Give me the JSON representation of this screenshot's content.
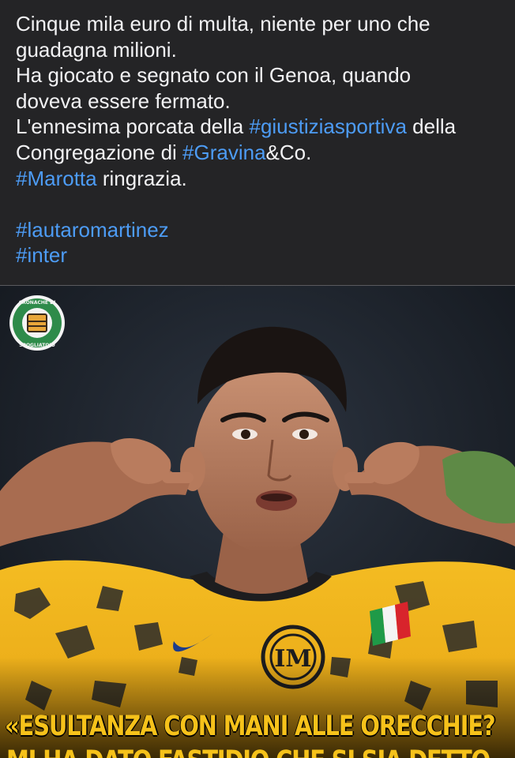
{
  "post": {
    "text_lines": {
      "l1": "Cinque mila euro di multa, niente per uno che",
      "l2": "guadagna milioni.",
      "l3": "Ha giocato e segnato con il Genoa, quando",
      "l4": "doveva essere fermato.",
      "l5_a": "L'ennesima porcata della ",
      "l5_tag": "#giustiziasportiva",
      "l5_b": " della",
      "l6_a": "Congregazione di ",
      "l6_tag": "#Gravina",
      "l6_b": "&Co.",
      "l7_tag": "#Marotta",
      "l7_b": " ringrazia."
    },
    "hashtags": {
      "tag1": "#lautaromartinez",
      "tag2": "#inter"
    }
  },
  "image": {
    "logo_text_top": "CRONACHE DI",
    "logo_text_bottom": "SPOGLIATOIO",
    "headline_line1": "«ESULTANZA CON MANI ALLE ORECCHIE?",
    "headline_line2": "MI HA DATO FASTIDIO CHE SI SIA DETTO"
  },
  "colors": {
    "background": "#242426",
    "text": "#f2f2f4",
    "hashtag": "#4d9cf5",
    "headline": "#f6c21a",
    "jersey": "#f0b31c",
    "logo": "#2e8b4a"
  },
  "icons": {
    "logo": "cronache-di-spogliatoio-logo-icon",
    "club_crest": "inter-crest-icon",
    "flag": "italian-flag-patch-icon"
  }
}
